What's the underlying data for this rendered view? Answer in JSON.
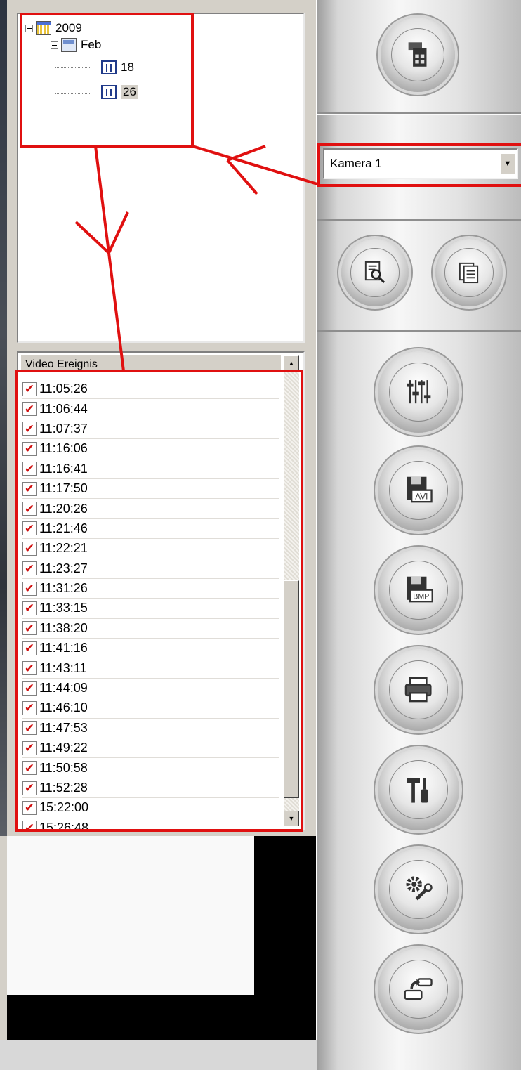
{
  "tree": {
    "year": "2009",
    "month": "Feb",
    "days": [
      "18",
      "26"
    ],
    "selected_day": "26"
  },
  "events": {
    "header": "Video Ereignis",
    "times": [
      "11:05:26",
      "11:06:44",
      "11:07:37",
      "11:16:06",
      "11:16:41",
      "11:17:50",
      "11:20:26",
      "11:21:46",
      "11:22:21",
      "11:23:27",
      "11:31:26",
      "11:33:15",
      "11:38:20",
      "11:41:16",
      "11:43:11",
      "11:44:09",
      "11:46:10",
      "11:47:53",
      "11:49:22",
      "11:50:58",
      "11:52:28",
      "15:22:00",
      "15:26:48"
    ],
    "check_glyph": "✔",
    "scroll_up": "▲",
    "scroll_down": "▼"
  },
  "camera_select": {
    "value": "Kamera 1",
    "arrow": "▼"
  },
  "toolbar_icons": [
    "layout-grid-icon",
    "search-document-icon",
    "window-list-icon",
    "equalizer-sliders-icon",
    "save-avi-icon",
    "save-bmp-icon",
    "printer-icon",
    "tools-hammer-screwdriver-icon",
    "gear-wrench-icon",
    "transfer-device-icon"
  ],
  "save_labels": {
    "avi": "AVI",
    "bmp": "BMP"
  },
  "colors": {
    "annotation": "#e01010",
    "check": "#d01010",
    "toolbar_light": "#f7f7f7",
    "panel": "#d4d0c8"
  }
}
